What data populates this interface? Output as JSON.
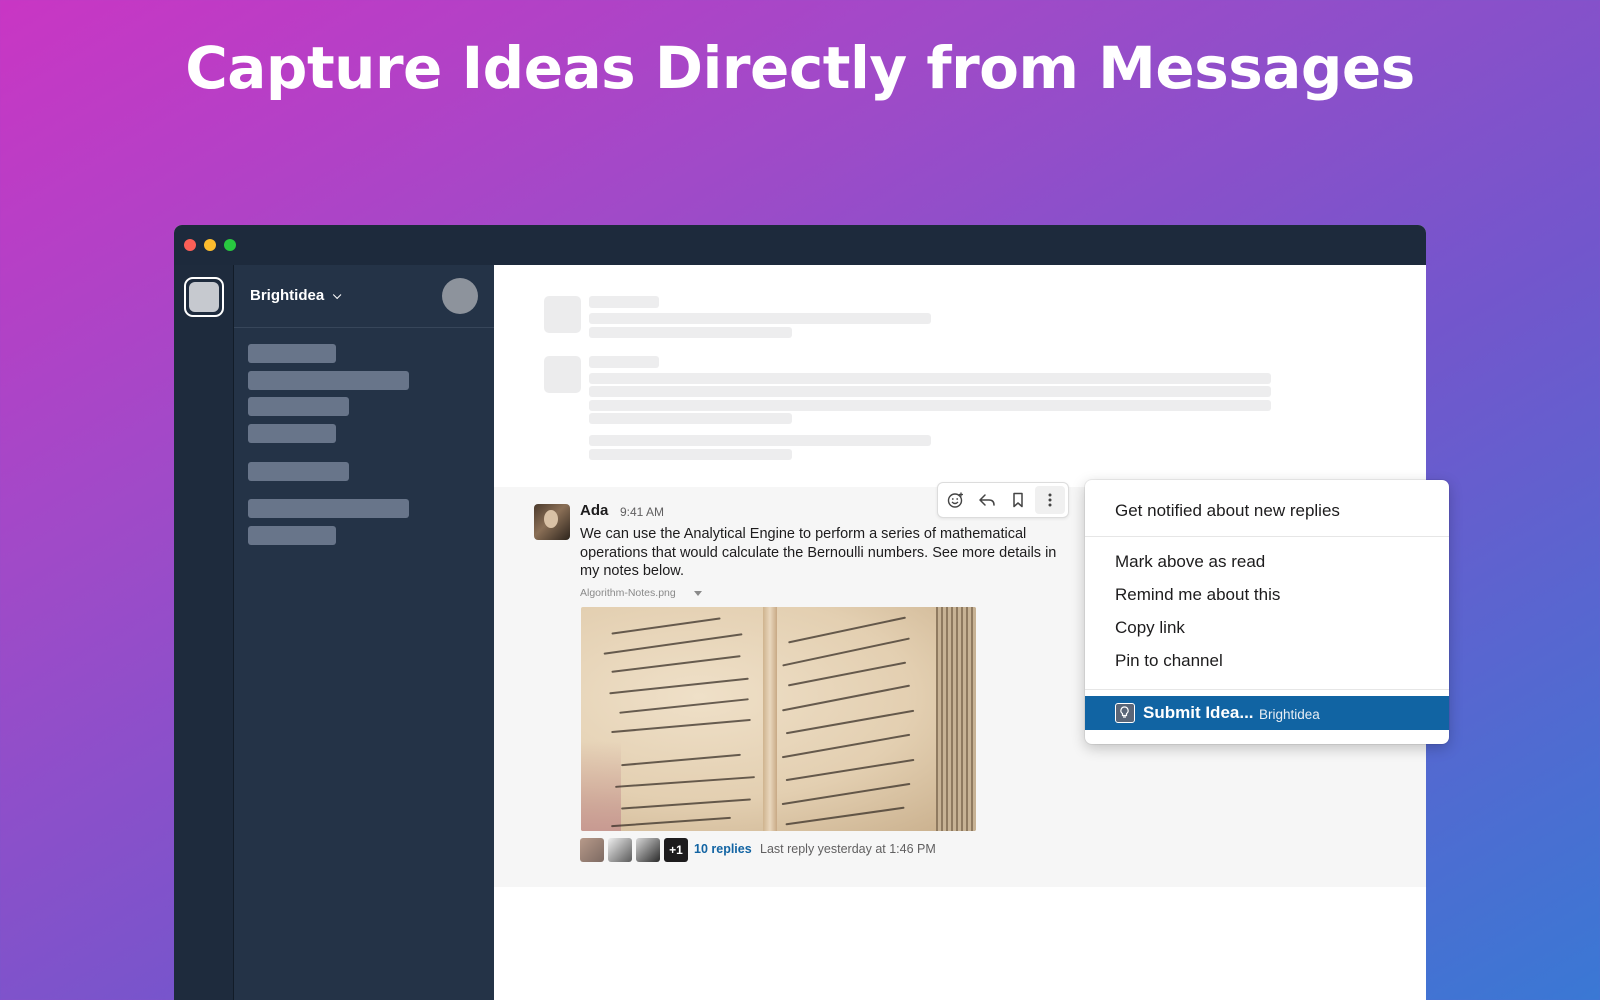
{
  "headline": "Capture Ideas Directly from Messages",
  "workspace": {
    "name": "Brightidea"
  },
  "message": {
    "author": "Ada",
    "time": "9:41 AM",
    "text": "We can use the Analytical Engine to perform a series of mathematical operations that would calculate the Bernoulli numbers. See more details in my notes below.",
    "attachment_name": "Algorithm-Notes.png",
    "thread": {
      "more_count": "+1",
      "replies": "10 replies",
      "last_reply": "Last reply yesterday at 1:46 PM"
    }
  },
  "toolbar_icons": [
    "emoji-reaction-icon",
    "reply-arrow-icon",
    "bookmark-icon",
    "more-vertical-icon"
  ],
  "context_menu": {
    "items": [
      "Get notified about new replies",
      "Mark above as read",
      "Remind me about this",
      "Copy link",
      "Pin to channel"
    ],
    "highlight_item": {
      "label": "Submit Idea...",
      "app": "Brightidea"
    }
  },
  "colors": {
    "sidebar": "#243347",
    "titlebar": "#1d2a3c",
    "highlight": "#1164a3",
    "link": "#1264a3"
  }
}
